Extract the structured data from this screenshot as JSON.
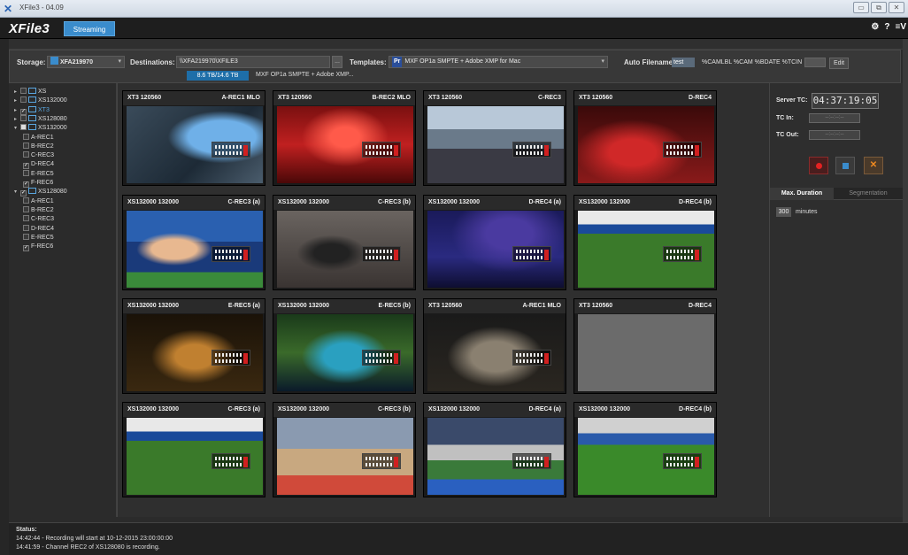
{
  "window": {
    "title": "XFile3 - 04.09",
    "buttons": [
      "▭",
      "⧉",
      "✕"
    ]
  },
  "app": {
    "logo": "XFile3",
    "tab": "Streaming",
    "icons": [
      "⚙",
      "?",
      "≡V"
    ]
  },
  "config": {
    "storage_label": "Storage:",
    "storage_value": "XFA219970",
    "destinations_label": "Destinations:",
    "destinations_value": "\\\\XFA219970\\XFILE3",
    "browse_label": "...",
    "capacity": "8.6 TB/14.6 TB",
    "destination_path": "MXF OP1a SMPTE + Adobe XMP...",
    "templates_label": "Templates:",
    "templates_badge": "Pr",
    "templates_value": "MXF OP1a SMPTE + Adobe XMP for Mac",
    "autofilename_label": "Auto Filename:",
    "autofilename_value": "test",
    "autofilename_pattern": "%CAMLBL %CAM %BDATE %TCIN",
    "edit_label": "Edit"
  },
  "tree": [
    {
      "label": "XS",
      "level": 0,
      "checked": "none",
      "expanded": false
    },
    {
      "label": "XS132000",
      "level": 0,
      "checked": "none",
      "expanded": false
    },
    {
      "label": "XT3",
      "level": 0,
      "checked": "on",
      "expanded": false,
      "selected": true
    },
    {
      "label": "XS128080",
      "level": 0,
      "checked": "none",
      "expanded": false
    },
    {
      "label": "XS132000",
      "level": 0,
      "checked": "part",
      "expanded": true
    },
    {
      "label": "A-REC1",
      "level": 1,
      "checked": "none"
    },
    {
      "label": "B-REC2",
      "level": 1,
      "checked": "none"
    },
    {
      "label": "C-REC3",
      "level": 1,
      "checked": "none"
    },
    {
      "label": "D-REC4",
      "level": 1,
      "checked": "on"
    },
    {
      "label": "E-REC5",
      "level": 1,
      "checked": "none"
    },
    {
      "label": "F-REC6",
      "level": 1,
      "checked": "on"
    },
    {
      "label": "XS128080",
      "level": 0,
      "checked": "on",
      "expanded": true
    },
    {
      "label": "A-REC1",
      "level": 1,
      "checked": "none"
    },
    {
      "label": "B-REC2",
      "level": 1,
      "checked": "none"
    },
    {
      "label": "C-REC3",
      "level": 1,
      "checked": "none"
    },
    {
      "label": "D-REC4",
      "level": 1,
      "checked": "none"
    },
    {
      "label": "E-REC5",
      "level": 1,
      "checked": "none"
    },
    {
      "label": "F-REC6",
      "level": 1,
      "checked": "on"
    }
  ],
  "tiles": [
    {
      "left": "XT3   120560",
      "right": "A-REC1 MLO",
      "scene": "blue"
    },
    {
      "left": "XT3   120560",
      "right": "B-REC2 MLO",
      "scene": "red-concert"
    },
    {
      "left": "XT3   120560",
      "right": "C-REC3",
      "scene": "studio"
    },
    {
      "left": "XT3   120560",
      "right": "D-REC4",
      "scene": "red-stage"
    },
    {
      "left": "XS132000 132000",
      "right": "C-REC3 (a)",
      "scene": "football-closeup"
    },
    {
      "left": "XS132000 132000",
      "right": "C-REC3 (b)",
      "scene": "singer"
    },
    {
      "left": "XS132000 132000",
      "right": "D-REC4 (a)",
      "scene": "crowd"
    },
    {
      "left": "XS132000 132000",
      "right": "D-REC4 (b)",
      "scene": "football"
    },
    {
      "left": "XS132000 132000",
      "right": "E-REC5 (a)",
      "scene": "orchestra"
    },
    {
      "left": "XS132000 132000",
      "right": "E-REC5 (b)",
      "scene": "stage-show"
    },
    {
      "left": "XT3   120560",
      "right": "A-REC1 MLO",
      "scene": "orchestra2"
    },
    {
      "left": "XT3   120560",
      "right": "D-REC4",
      "scene": "empty"
    },
    {
      "left": "XS132000 132000",
      "right": "C-REC3 (a)",
      "scene": "football"
    },
    {
      "left": "XS132000 132000",
      "right": "C-REC3 (b)",
      "scene": "athletics"
    },
    {
      "left": "XS132000 132000",
      "right": "D-REC4 (a)",
      "scene": "stadium"
    },
    {
      "left": "XS132000 132000",
      "right": "D-REC4 (b)",
      "scene": "football2"
    }
  ],
  "right_panel": {
    "server_tc_label": "Server TC:",
    "server_tc": "04:37:19:05",
    "tc_in_label": "TC In:",
    "tc_in": "--:--:--:--",
    "tc_out_label": "TC Out:",
    "tc_out": "--:--:--:--",
    "tab_active": "Max. Duration",
    "tab_inactive": "Segmentation",
    "duration_value": "300",
    "duration_unit": "minutes"
  },
  "status": {
    "label": "Status:",
    "lines": [
      "14:42:44 - Recording will start at 10-12-2015 23:00:00:00",
      "14:41:59 - Channel REC2 of XS128080 is recording."
    ]
  }
}
